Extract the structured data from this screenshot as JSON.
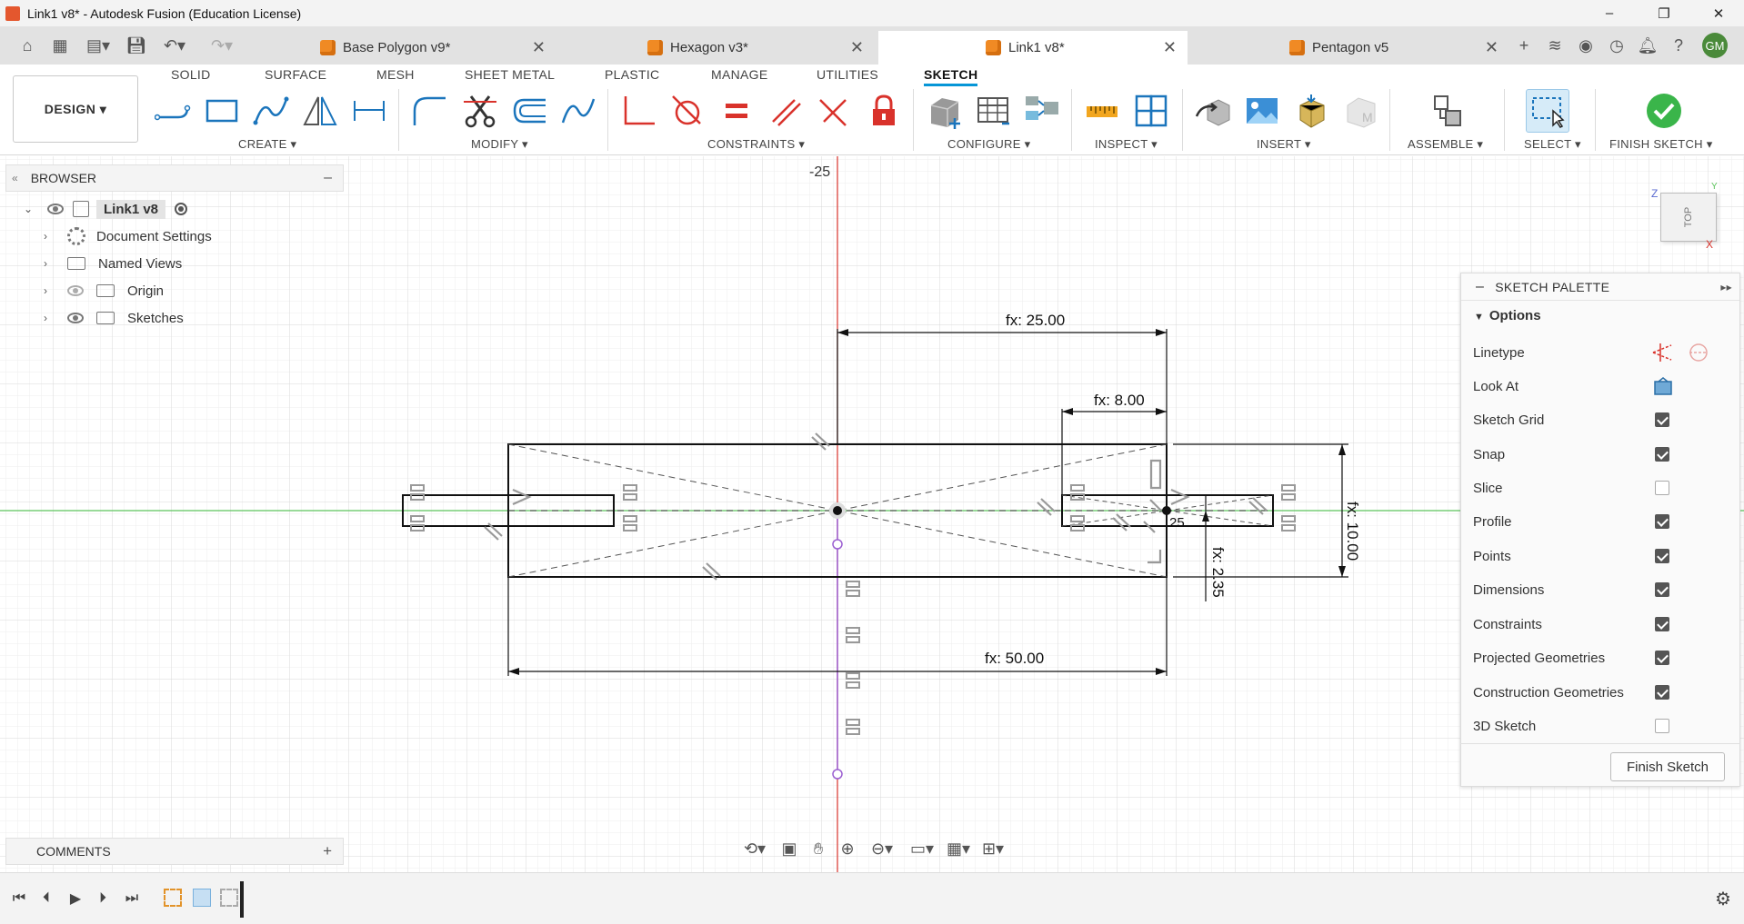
{
  "window": {
    "title": "Link1 v8* - Autodesk Fusion (Education License)",
    "controls": [
      "–",
      "❐",
      "✕"
    ]
  },
  "tabs": [
    {
      "label": "Base Polygon v9*",
      "active": false
    },
    {
      "label": "Hexagon v3*",
      "active": false
    },
    {
      "label": "Link1 v8*",
      "active": true
    },
    {
      "label": "Pentagon v5",
      "active": false
    }
  ],
  "user": {
    "initials": "GM"
  },
  "workspace": {
    "label": "DESIGN ▾"
  },
  "toolbar_tabs": [
    "SOLID",
    "SURFACE",
    "MESH",
    "SHEET METAL",
    "PLASTIC",
    "MANAGE",
    "UTILITIES",
    "SKETCH"
  ],
  "active_toolbar_tab": "SKETCH",
  "groups": {
    "create": "CREATE ▾",
    "modify": "MODIFY ▾",
    "constraints": "CONSTRAINTS ▾",
    "configure": "CONFIGURE ▾",
    "inspect": "INSPECT ▾",
    "insert": "INSERT ▾",
    "assemble": "ASSEMBLE ▾",
    "select": "SELECT ▾",
    "finish": "FINISH SKETCH ▾"
  },
  "browser": {
    "title": "BROWSER",
    "root": "Link1 v8",
    "items": [
      "Document Settings",
      "Named Views",
      "Origin",
      "Sketches"
    ]
  },
  "comments": {
    "title": "COMMENTS"
  },
  "canvas": {
    "axis_label": "-25",
    "dim_25": "fx: 25.00",
    "dim_8": "fx: 8.00",
    "dim_50": "fx: 50.00",
    "dim_10": "fx: 10.00",
    "dim_235": "fx: 2.35",
    "small_25": "25"
  },
  "viewcube": {
    "face": "TOP",
    "z": "Z",
    "x": "X",
    "y": "Y"
  },
  "palette": {
    "title": "SKETCH PALETTE",
    "section": "Options",
    "options": [
      {
        "label": "Linetype",
        "kind": "icons"
      },
      {
        "label": "Look At",
        "kind": "icon"
      },
      {
        "label": "Sketch Grid",
        "checked": true
      },
      {
        "label": "Snap",
        "checked": true
      },
      {
        "label": "Slice",
        "checked": false
      },
      {
        "label": "Profile",
        "checked": true
      },
      {
        "label": "Points",
        "checked": true
      },
      {
        "label": "Dimensions",
        "checked": true
      },
      {
        "label": "Constraints",
        "checked": true
      },
      {
        "label": "Projected Geometries",
        "checked": true
      },
      {
        "label": "Construction Geometries",
        "checked": true
      },
      {
        "label": "3D Sketch",
        "checked": false
      }
    ],
    "finish_button": "Finish Sketch"
  },
  "colors": {
    "accent": "#0696d7",
    "finish_green": "#3ab54a",
    "constraint_red": "#d9322b",
    "axis_red": "#d9322b",
    "axis_green": "#5cc35c",
    "construction_purple": "#9b5fd1"
  }
}
